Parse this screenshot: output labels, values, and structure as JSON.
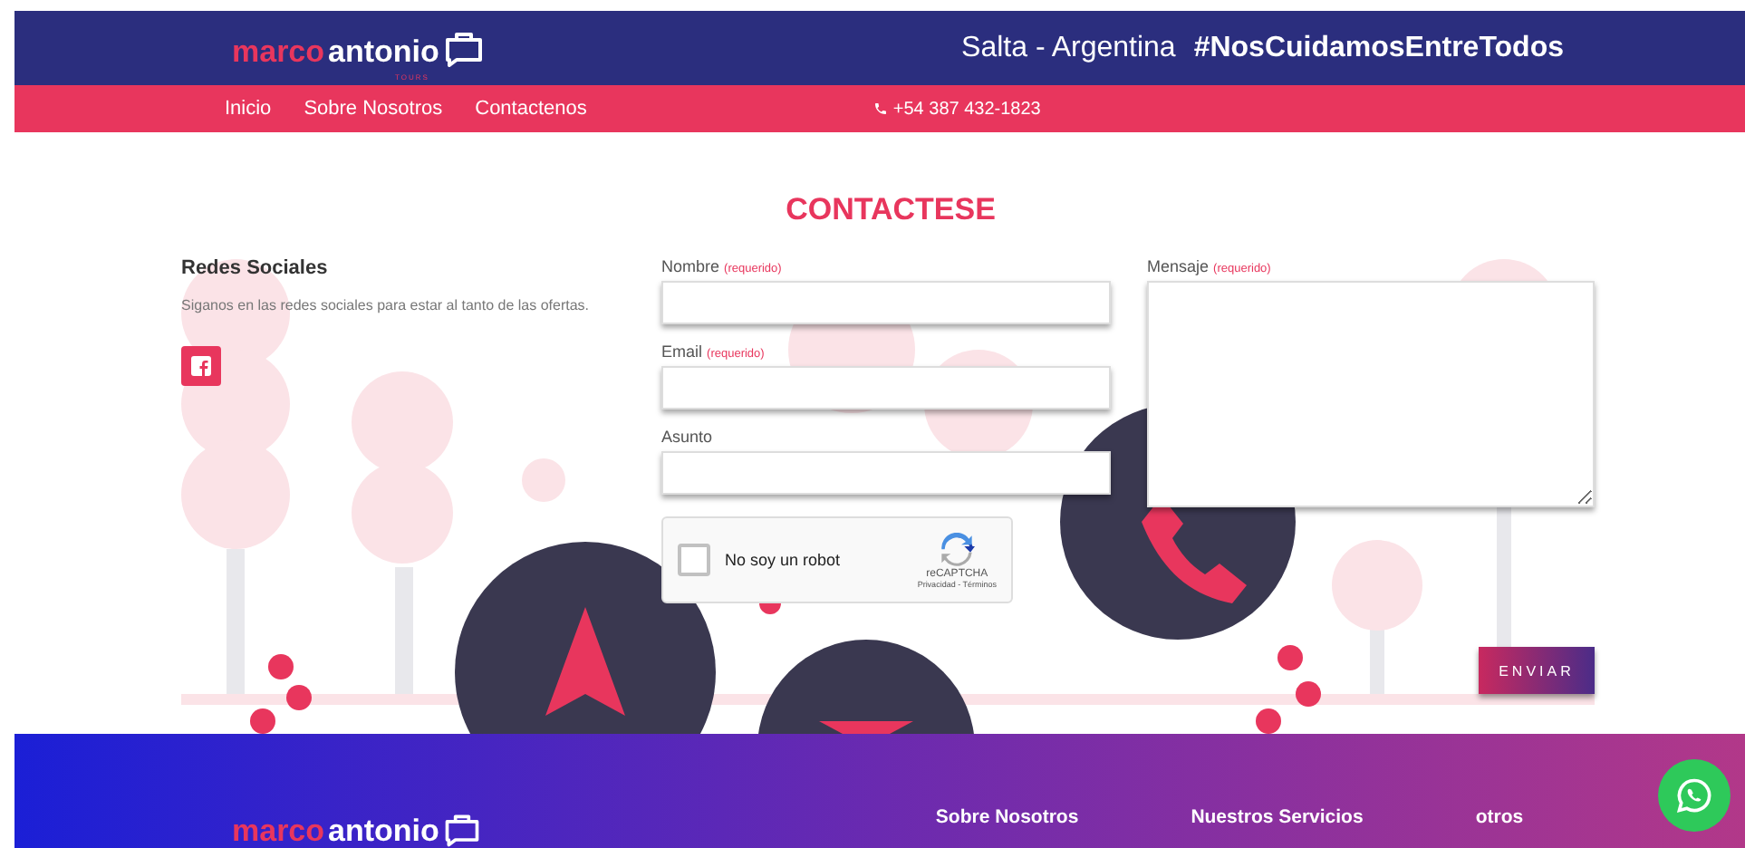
{
  "header": {
    "logo": {
      "part_1": "marco",
      "part_2": "antonio",
      "tagline": "TOURS"
    },
    "location": "Salta - Argentina",
    "hashtag": "#NosCuidamosEntreTodos"
  },
  "nav": {
    "items": [
      {
        "label": "Inicio"
      },
      {
        "label": "Sobre Nosotros"
      },
      {
        "label": "Contactenos"
      }
    ],
    "phone": "+54 387 432-1823"
  },
  "contact": {
    "title": "CONTACTESE",
    "social": {
      "heading": "Redes Sociales",
      "text": "Siganos en las redes sociales para estar al tanto de las ofertas."
    },
    "fields": [
      {
        "label": "Nombre",
        "required_note": "(requerido)"
      },
      {
        "label": "Email",
        "required_note": "(requerido)"
      },
      {
        "label": "Asunto"
      }
    ],
    "captcha": {
      "label": "No soy un robot",
      "checked": false,
      "brand": "reCAPTCHA",
      "links": "Privacidad - Términos"
    },
    "message": {
      "label": "Mensaje",
      "required_note": "(requerido)"
    },
    "submit": "ENVIAR"
  },
  "footer": {
    "logo": {
      "part_1": "marco",
      "part_2": "antonio"
    },
    "links": [
      {
        "label": "Sobre Nosotros"
      },
      {
        "label": "Nuestros Servicios"
      },
      {
        "label": "otros"
      }
    ]
  }
}
